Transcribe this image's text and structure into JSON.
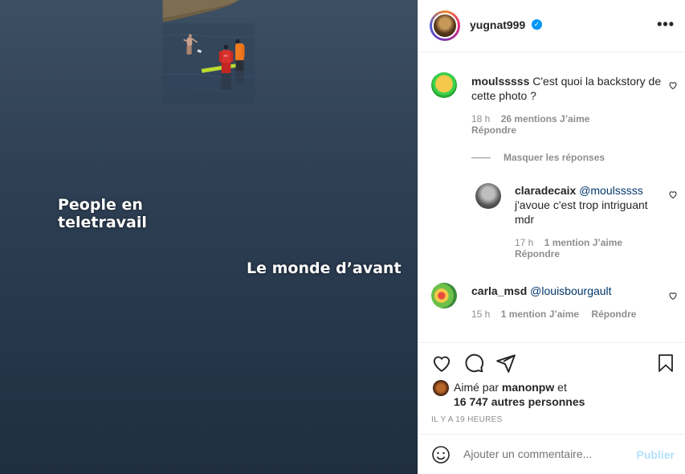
{
  "post": {
    "caption_left": "People en teletravail",
    "caption_right": "Le monde d’avant"
  },
  "header": {
    "username": "yugnat999",
    "verified": true,
    "more_icon": "more-horizontal-icon"
  },
  "comments": [
    {
      "user": "moulsssss",
      "text": "C'est quoi la backstory de cette photo ?",
      "time": "18 h",
      "likes": "26 mentions J’aime",
      "reply_label": "Répondre"
    },
    {
      "user": "claradecaix",
      "mention": "@moulsssss",
      "text": "j'avoue c'est trop intriguant mdr",
      "time": "17 h",
      "likes": "1 mention J’aime",
      "reply_label": "Répondre"
    },
    {
      "user": "carla_msd",
      "mention": "@louisbourgault",
      "time": "15 h",
      "likes": "1 mention J’aime",
      "reply_label": "Répondre"
    }
  ],
  "hide_replies": "Masquer les réponses",
  "liked_by": {
    "prefix": "Aimé par",
    "user": "manonpw",
    "suffix": "et",
    "others": "16 747 autres personnes"
  },
  "timestamp": "IL Y A 19 HEURES",
  "add_comment": {
    "placeholder": "Ajouter un commentaire...",
    "publish": "Publier"
  },
  "colors": {
    "verified": "#0095f6",
    "mention": "#00376b",
    "publish_disabled": "#b2dffc",
    "muted": "#8e8e8e"
  }
}
